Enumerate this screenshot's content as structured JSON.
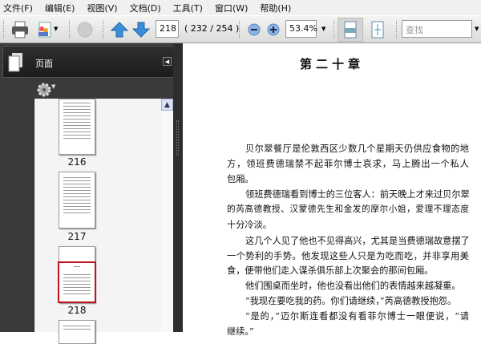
{
  "menu": [
    "文件(F)",
    "编辑(E)",
    "视图(V)",
    "文档(D)",
    "工具(T)",
    "窗口(W)",
    "帮助(H)"
  ],
  "toolbar": {
    "page_input": "218",
    "page_count": "( 232 / 254 )",
    "zoom": "53.4%",
    "search_placeholder": "查找"
  },
  "panel": {
    "title": "页面",
    "thumbnails": [
      {
        "label": "216"
      },
      {
        "label": "217"
      },
      {
        "label": "218",
        "selected": true
      }
    ]
  },
  "colors": {
    "selection": "#c0141c",
    "panel": "#3a3a3a"
  },
  "document": {
    "chapter_title": "第二十章",
    "lines": [
      "贝尔翠餐厅是伦敦西区少数几个星期天仍供应食物的地",
      "方，领班费德瑞禁不起菲尔博士哀求，马上腾出一个私人",
      "包厢。",
      "领班费德瑞看到博士的三位客人：前天晚上才来过贝尔翠",
      "的芮高德教授、汉蒙德先生和金发的摩尔小姐，爱理不理态度",
      "十分冷淡。",
      "这几个人见了他也不见得高兴，尤其是当费德瑞故意摆了",
      "一个势利的手势。他发现这些人只是为吃而吃，并非享用美",
      "食，便带他们走入谋杀俱乐部上次聚会的那间包厢。",
      "他们围桌而坐时，他也没看出他们的表情越来越凝重。",
      "“我现在要吃我的药。你们请继续，”芮高德教授抱怨。",
      "“是的，”迈尔斯连看都没有看菲尔博士一眼便说，“请",
      "继续。”"
    ]
  }
}
